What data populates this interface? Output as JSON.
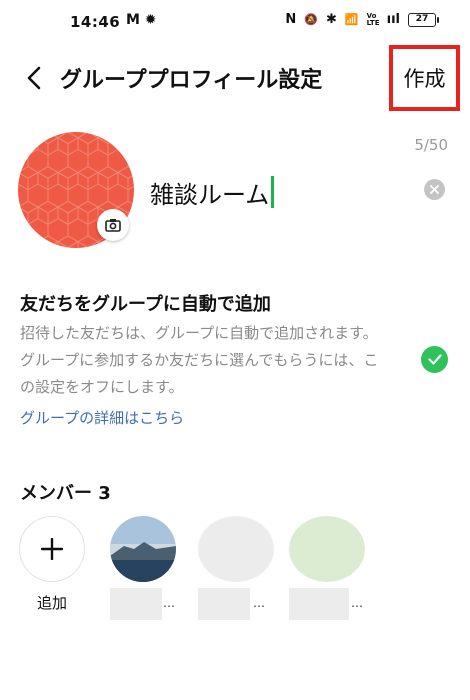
{
  "status_bar": {
    "time": "14:46",
    "left_icons": "M ✹",
    "right_icons": [
      "N",
      "🔕",
      "✱",
      "📶",
      "Vo LTE",
      "ııl"
    ],
    "battery": "27"
  },
  "header": {
    "title": "グループプロフィール設定",
    "create_label": "作成",
    "highlight_color": "#e8231f"
  },
  "group_name": {
    "value": "雑談ルーム",
    "char_count": "5/50",
    "cursor_color": "#19b64d"
  },
  "avatar": {
    "color": "#ee5a45"
  },
  "auto_add": {
    "title": "友だちをグループに自動で追加",
    "description": "招待した友だちは、グループに自動で追加されます。グループに参加するか友だちに選んでもらうには、この設定をオフにします。",
    "link": "グループの詳細はこちら",
    "enabled": true,
    "toggle_color": "#2fc15a"
  },
  "members": {
    "title": "メンバー 3",
    "add_label": "追加",
    "ellipsis": "…"
  }
}
